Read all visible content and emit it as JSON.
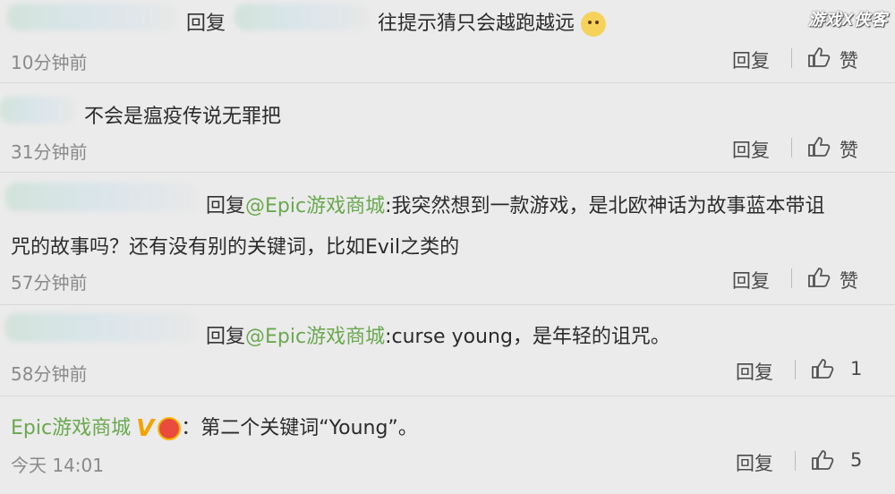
{
  "watermark": "游戏X侠客",
  "comments": [
    {
      "reply_word": "回复",
      "text": "往提示猜只会越跑越远",
      "emoji": "doge-emoji",
      "time": "10分钟前",
      "reply_label": "回复",
      "like_label": "赞"
    },
    {
      "text": "不会是瘟疫传说无罪把",
      "time": "31分钟前",
      "reply_label": "回复",
      "like_label": "赞"
    },
    {
      "reply_word": "回复",
      "mention": "@Epic游戏商城",
      "text_line1": ":我突然想到一款游戏，是北欧神话为故事蓝本带诅",
      "text_line2": "咒的故事吗？还有没有别的关键词，比如Evil之类的",
      "time": "57分钟前",
      "reply_label": "回复",
      "like_label": "赞"
    },
    {
      "reply_word": "回复",
      "mention": "@Epic游戏商城",
      "text": ":curse young，是年轻的诅咒。",
      "time": "58分钟前",
      "reply_label": "回复",
      "like_label": "1"
    },
    {
      "username": "Epic游戏商城",
      "verified": "V",
      "text": "：第二个关键词“Young”。",
      "time": "今天 14:01",
      "reply_label": "回复",
      "like_label": "5"
    }
  ]
}
